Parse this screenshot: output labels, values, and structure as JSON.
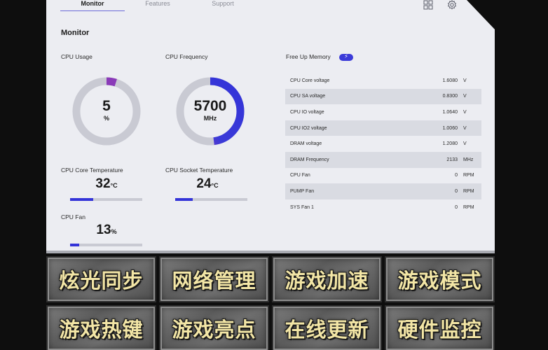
{
  "tabs": [
    {
      "label": "Monitor"
    },
    {
      "label": "Features"
    },
    {
      "label": "Support"
    }
  ],
  "icons": {
    "grid": "grid-icon",
    "settings": "gear-icon",
    "memory_toggle": "lightning-icon"
  },
  "page_title": "Monitor",
  "cpu_usage": {
    "label": "CPU Usage",
    "value": "5",
    "unit": "%",
    "percent": 5
  },
  "cpu_frequency": {
    "label": "CPU Frequency",
    "value": "5700",
    "unit": "MHz",
    "percent": 48
  },
  "cpu_core_temp": {
    "label": "CPU Core Temperature",
    "value": "32",
    "unit": "°C",
    "percent": 32
  },
  "cpu_socket_temp": {
    "label": "CPU Socket Temperature",
    "value": "24",
    "unit": "°C",
    "percent": 24
  },
  "cpu_fan": {
    "label": "CPU Fan",
    "value": "13",
    "unit": "%",
    "percent": 13
  },
  "free_memory": {
    "label": "Free Up Memory",
    "toggle_glyph": "⚡"
  },
  "sensors": [
    {
      "name": "CPU Core voltage",
      "value": "1.6080",
      "unit": "V"
    },
    {
      "name": "CPU SA voltage",
      "value": "0.8300",
      "unit": "V"
    },
    {
      "name": "CPU IO voltage",
      "value": "1.0640",
      "unit": "V"
    },
    {
      "name": "CPU IO2 voltage",
      "value": "1.0060",
      "unit": "V"
    },
    {
      "name": "DRAM voltage",
      "value": "1.2080",
      "unit": "V"
    },
    {
      "name": "DRAM Frequency",
      "value": "2133",
      "unit": "MHz"
    },
    {
      "name": "CPU Fan",
      "value": "0",
      "unit": "RPM"
    },
    {
      "name": "PUMP Fan",
      "value": "0",
      "unit": "RPM"
    },
    {
      "name": "SYS Fan 1",
      "value": "0",
      "unit": "RPM"
    }
  ],
  "feature_tiles": [
    {
      "label": "炫光同步"
    },
    {
      "label": "网络管理"
    },
    {
      "label": "游戏加速"
    },
    {
      "label": "游戏模式"
    },
    {
      "label": "游戏热键"
    },
    {
      "label": "游戏亮点"
    },
    {
      "label": "在线更新"
    },
    {
      "label": "硬件监控"
    }
  ],
  "colors": {
    "accent": "#3333d8",
    "accent_purple": "#8a3ab8",
    "track": "#c9cad3",
    "panel_bg": "#ecedf2",
    "tile_text": "#f3e6a6"
  }
}
